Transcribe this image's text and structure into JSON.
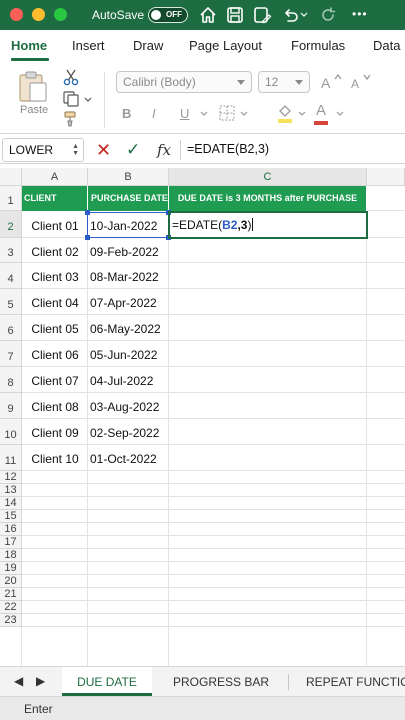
{
  "titlebar": {
    "autosave_label": "AutoSave",
    "autosave_state": "OFF",
    "brand_color": "#1e6c41",
    "icons": [
      "home-icon",
      "save-icon",
      "save-as-icon",
      "undo-icon",
      "redo-icon"
    ]
  },
  "ribbon_tabs": [
    "Home",
    "Insert",
    "Draw",
    "Page Layout",
    "Formulas",
    "Data"
  ],
  "ribbon": {
    "paste_label": "Paste",
    "font_name": "Calibri (Body)",
    "font_size": "12",
    "bold": "B",
    "italic": "I",
    "underline": "U",
    "font_color_glyph": "A"
  },
  "formula_bar": {
    "name_box": "LOWER",
    "fx": "fx",
    "formula": "=EDATE(B2,3)"
  },
  "grid": {
    "columns": [
      "A",
      "B",
      "C"
    ],
    "rows": [
      "1",
      "2",
      "3",
      "4",
      "5",
      "6",
      "7",
      "8",
      "9",
      "10",
      "11",
      "12",
      "13",
      "14",
      "15",
      "16",
      "17",
      "18",
      "19",
      "20",
      "21",
      "22",
      "23"
    ],
    "header_fill": "#1f9c52",
    "headers": [
      "CLIENT",
      "PURCHASE DATE",
      "DUE DATE is 3 MONTHS after PURCHASE"
    ],
    "data": [
      {
        "client": "Client 01",
        "date": "10-Jan-2022"
      },
      {
        "client": "Client 02",
        "date": "09-Feb-2022"
      },
      {
        "client": "Client 03",
        "date": "08-Mar-2022"
      },
      {
        "client": "Client 04",
        "date": "07-Apr-2022"
      },
      {
        "client": "Client 05",
        "date": "06-May-2022"
      },
      {
        "client": "Client 06",
        "date": "05-Jun-2022"
      },
      {
        "client": "Client 07",
        "date": "04-Jul-2022"
      },
      {
        "client": "Client 08",
        "date": "03-Aug-2022"
      },
      {
        "client": "Client 09",
        "date": "02-Sep-2022"
      },
      {
        "client": "Client 10",
        "date": "01-Oct-2022"
      }
    ],
    "edit": {
      "prefix": "=EDATE(",
      "ref": "B2",
      "suffix_blue": ",3",
      "close": ")"
    }
  },
  "sheet_tabs": [
    "DUE DATE",
    "PROGRESS BAR",
    "REPEAT FUNCTION"
  ],
  "status": {
    "mode": "Enter"
  }
}
